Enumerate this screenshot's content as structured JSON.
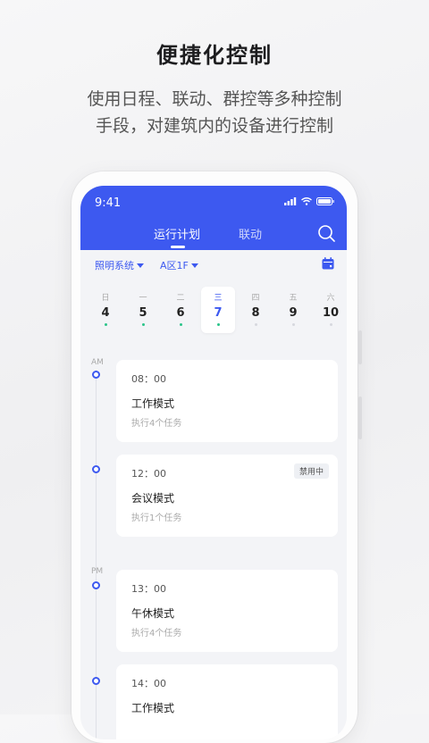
{
  "headline": "便捷化控制",
  "subline": [
    "使用日程、联动、群控等多种控制",
    "手段，对建筑内的设备进行控制"
  ],
  "status": {
    "time": "9:41"
  },
  "tabs": [
    {
      "label": "运行计划",
      "active": true
    },
    {
      "label": "联动",
      "active": false
    }
  ],
  "filters": [
    {
      "label": "照明系统"
    },
    {
      "label": "A区1F"
    }
  ],
  "week": [
    {
      "name": "日",
      "num": "4",
      "dot": "#2bc48a"
    },
    {
      "name": "一",
      "num": "5",
      "dot": "#2bc48a"
    },
    {
      "name": "二",
      "num": "6",
      "dot": "#2bc48a"
    },
    {
      "name": "三",
      "num": "7",
      "dot": "#2bc48a",
      "selected": true
    },
    {
      "name": "四",
      "num": "8",
      "dot": "#d6d8de"
    },
    {
      "name": "五",
      "num": "9",
      "dot": "#d6d8de"
    },
    {
      "name": "六",
      "num": "10",
      "dot": "#d6d8de"
    }
  ],
  "periods": {
    "am": "AM",
    "pm": "PM"
  },
  "schedule": [
    {
      "time": "08：00",
      "name": "工作模式",
      "sub": "执行4个任务"
    },
    {
      "time": "12：00",
      "name": "会议模式",
      "sub": "执行1个任务",
      "badge": "禁用中"
    },
    {
      "time": "13：00",
      "name": "午休模式",
      "sub": "执行4个任务"
    },
    {
      "time": "14：00",
      "name": "工作模式",
      "sub": ""
    }
  ],
  "colors": {
    "accent": "#3d59f0",
    "dot_active": "#2bc48a",
    "dot_inactive": "#d6d8de"
  },
  "icons": {
    "signal": "signal-icon",
    "wifi": "wifi-icon",
    "battery": "battery-icon",
    "search": "search-icon",
    "calendar": "calendar-icon"
  }
}
